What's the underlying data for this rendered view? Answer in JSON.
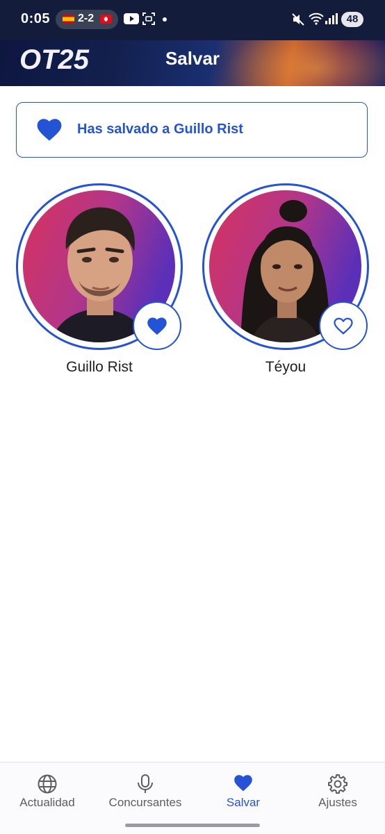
{
  "status_bar": {
    "time": "0:05",
    "score": "2-2",
    "battery": "48",
    "icons": [
      "flag-spain-icon",
      "flag-turkey-icon",
      "youtube-icon",
      "screenshot-icon",
      "mute-icon",
      "wifi-icon",
      "signal-icon"
    ]
  },
  "header": {
    "logo_text": "OT25",
    "title": "Salvar"
  },
  "banner": {
    "icon": "heart-filled-icon",
    "text": "Has salvado a Guillo Rist"
  },
  "contestants": [
    {
      "name": "Guillo Rist",
      "saved": true,
      "icon": "heart-filled-icon"
    },
    {
      "name": "Téyou",
      "saved": false,
      "icon": "heart-outline-icon"
    }
  ],
  "nav": {
    "items": [
      {
        "label": "Actualidad",
        "icon": "globe-icon"
      },
      {
        "label": "Concursantes",
        "icon": "microphone-icon"
      },
      {
        "label": "Salvar",
        "icon": "heart-icon"
      },
      {
        "label": "Ajustes",
        "icon": "gear-icon"
      }
    ],
    "active": "Salvar"
  },
  "colors": {
    "accent": "#2453d6",
    "status_bar": "#141c3b",
    "text": "#1f1f1f",
    "nav_inactive": "#5c5c63"
  }
}
